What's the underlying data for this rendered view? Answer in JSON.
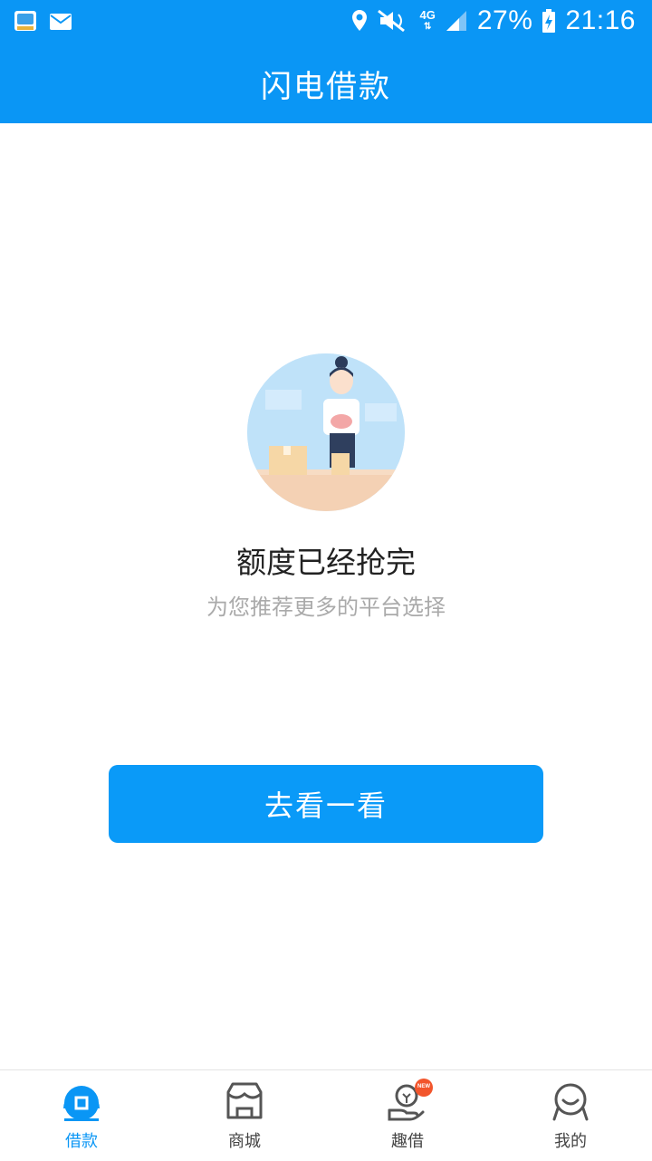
{
  "status_bar": {
    "battery": "27%",
    "time": "21:16",
    "network": "4G"
  },
  "app_bar": {
    "title": "闪电借款"
  },
  "empty_state": {
    "title": "额度已经抢完",
    "subtitle": "为您推荐更多的平台选择",
    "button_label": "去看一看"
  },
  "tab_bar": {
    "items": [
      {
        "label": "借款",
        "icon": "loan-icon",
        "active": true
      },
      {
        "label": "商城",
        "icon": "store-icon",
        "active": false
      },
      {
        "label": "趣借",
        "icon": "hand-coin-icon",
        "badge": "NEW",
        "active": false
      },
      {
        "label": "我的",
        "icon": "profile-icon",
        "active": false
      }
    ]
  },
  "colors": {
    "primary": "#0a96f5",
    "button": "#0a9af8",
    "text_dark": "#222222",
    "text_muted": "#aaaaaa"
  }
}
